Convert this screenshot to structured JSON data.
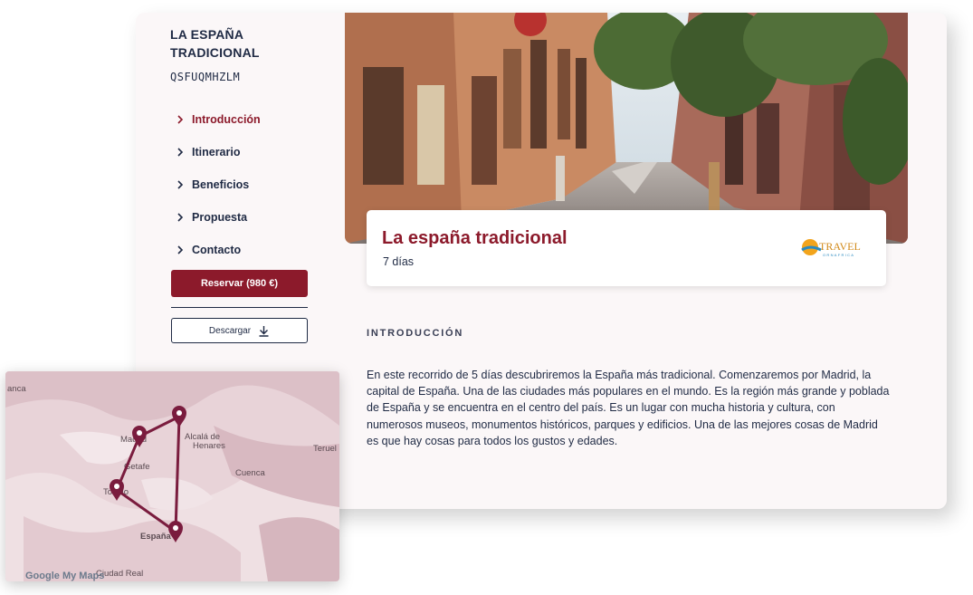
{
  "sidebar": {
    "brand_title": "LA ESPAÑA TRADICIONAL",
    "code": "QSFUQMHZLM",
    "nav": [
      {
        "label": "Introducción",
        "active": true
      },
      {
        "label": "Itinerario",
        "active": false
      },
      {
        "label": "Beneficios",
        "active": false
      },
      {
        "label": "Propuesta",
        "active": false
      },
      {
        "label": "Contacto",
        "active": false
      }
    ],
    "reserve_label": "Reservar (980 €)",
    "download_label": "Descargar"
  },
  "hero": {
    "title": "La españa tradicional",
    "duration": "7 días",
    "logo_text": "TRAVEL",
    "logo_subtext": "ORNAFRICA"
  },
  "intro": {
    "section_label": "INTRODUCCIÓN",
    "text": "En este recorrido de 5 días descubriremos la España más tradicional. Comenzaremos por Madrid, la capital de España. Una de las ciudades más populares en el mundo. Es la región más grande y poblada de España y se encuentra en el centro del país. Es un lugar con mucha historia y cultura, con numerosos museos, monumentos históricos, parques y edificios. Una de las mejores cosas de Madrid es que hay cosas para todos los gustos y edades."
  },
  "map": {
    "labels": {
      "salamanca": "anca",
      "madrid": "Madrid",
      "alcala": "Alcalá de",
      "henares": "Henares",
      "getafe": "Getafe",
      "toledo": "Toledo",
      "cuenca": "Cuenca",
      "teruel": "Teruel",
      "espana": "España",
      "ciudad_real": "Ciudad Real"
    },
    "attribution": "Google My Maps",
    "marker_color": "#7a1c3e"
  },
  "colors": {
    "accent": "#8c1a2b",
    "navy": "#1f2a44"
  }
}
